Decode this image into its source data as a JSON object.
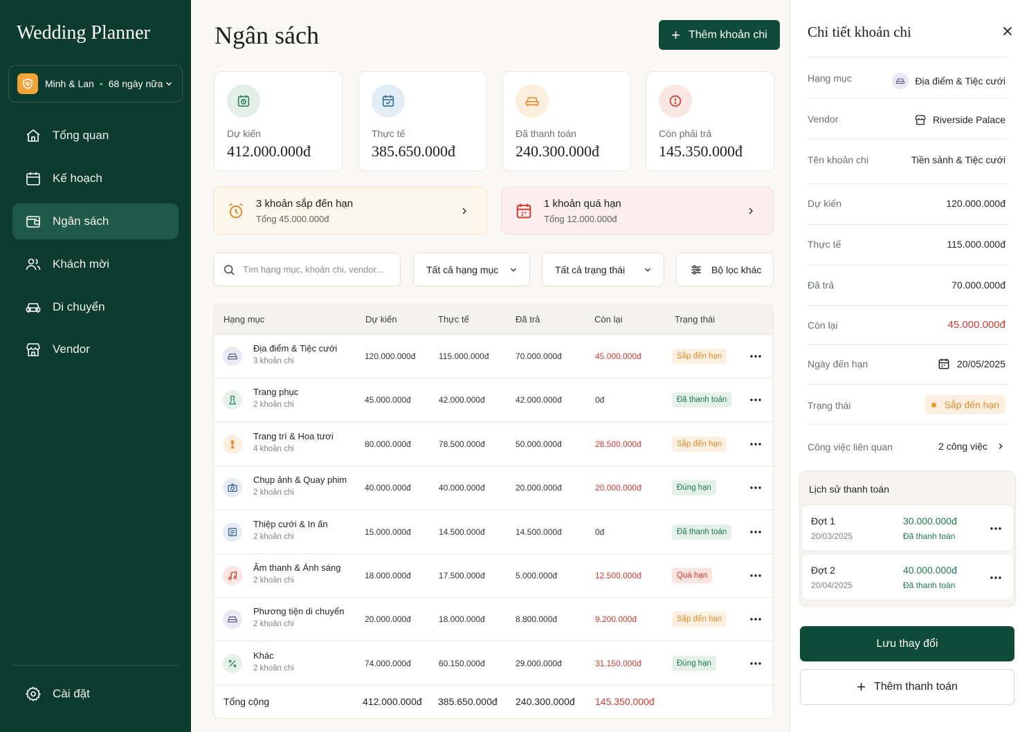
{
  "app": {
    "title": "Wedding Planner"
  },
  "couple": {
    "names": "Minh & Lan",
    "countdown": "68 ngày nữa"
  },
  "nav": [
    {
      "label": "Tổng quan",
      "icon": "home-icon"
    },
    {
      "label": "Kế hoạch",
      "icon": "calendar-icon"
    },
    {
      "label": "Ngân sách",
      "icon": "wallet-icon",
      "active": true
    },
    {
      "label": "Khách mời",
      "icon": "users-icon"
    },
    {
      "label": "Di chuyển",
      "icon": "car-icon"
    },
    {
      "label": "Vendor",
      "icon": "store-icon"
    }
  ],
  "settings": {
    "label": "Cài đặt",
    "icon": "gear-icon"
  },
  "page": {
    "title": "Ngân sách",
    "add_label": "Thêm khoản chi"
  },
  "summary": [
    {
      "label": "Dự kiến",
      "value": "412.000.000đ",
      "icon": "clock-calendar-icon",
      "color": "#2e7d5b"
    },
    {
      "label": "Thực tế",
      "value": "385.650.000đ",
      "icon": "calendar-check-icon",
      "color": "#2f6f9e"
    },
    {
      "label": "Đã thanh toán",
      "value": "240.300.000đ",
      "icon": "car-icon",
      "color": "#e08a2e"
    },
    {
      "label": "Còn phải trả",
      "value": "145.350.000đ",
      "icon": "alert-clock-icon",
      "color": "#d33a2f"
    }
  ],
  "alerts": {
    "upcoming": {
      "title": "3 khoản sắp đến hạn",
      "sub": "Tổng 45.000.000đ"
    },
    "overdue": {
      "title": "1 khoản quá hạn",
      "sub": "Tổng 12.000.000đ"
    }
  },
  "filters": {
    "search_placeholder": "Tìm hạng mục, khoản chi, vendor...",
    "category": "Tất cả hạng mục",
    "status": "Tất cả trạng thái",
    "more": "Bộ lọc khác"
  },
  "table": {
    "headers": [
      "Hạng mục",
      "Dự kiến",
      "Thực tế",
      "Đã trả",
      "Còn lại",
      "Trạng thái"
    ],
    "rows": [
      {
        "name": "Địa điểm & Tiệc cưới",
        "sub": "3 khoản chi",
        "icon": "car-icon",
        "planned": "120.000.000đ",
        "actual": "115.000.000đ",
        "paid": "70.000.000đ",
        "remaining": "45.000.000đ",
        "status": "Sắp đến hạn",
        "kind": "due"
      },
      {
        "name": "Trang phục",
        "sub": "2 khoản chi",
        "icon": "dress-icon",
        "planned": "45.000.000đ",
        "actual": "42.000.000đ",
        "paid": "42.000.000đ",
        "remaining": "0đ",
        "status": "Đã thanh toán",
        "kind": "paid"
      },
      {
        "name": "Trang trí & Hoa tươi",
        "sub": "4 khoản chi",
        "icon": "flower-icon",
        "planned": "80.000.000đ",
        "actual": "78.500.000đ",
        "paid": "50.000.000đ",
        "remaining": "28.500.000đ",
        "status": "Sắp đến hạn",
        "kind": "due"
      },
      {
        "name": "Chụp ảnh & Quay phim",
        "sub": "2 khoản chi",
        "icon": "camera-icon",
        "planned": "40.000.000đ",
        "actual": "40.000.000đ",
        "paid": "20.000.000đ",
        "remaining": "20.000.000đ",
        "status": "Đúng hạn",
        "kind": "ontime"
      },
      {
        "name": "Thiệp cưới & In ấn",
        "sub": "2 khoản chi",
        "icon": "card-icon",
        "planned": "15.000.000đ",
        "actual": "14.500.000đ",
        "paid": "14.500.000đ",
        "remaining": "0đ",
        "status": "Đã thanh toán",
        "kind": "paid"
      },
      {
        "name": "Âm thanh & Ánh sáng",
        "sub": "2 khoản chi",
        "icon": "music-icon",
        "planned": "18.000.000đ",
        "actual": "17.500.000đ",
        "paid": "5.000.000đ",
        "remaining": "12.500.000đ",
        "status": "Quá hạn",
        "kind": "overdue"
      },
      {
        "name": "Phương tiện di chuyển",
        "sub": "2 khoản chi",
        "icon": "car-icon",
        "planned": "20.000.000đ",
        "actual": "18.000.000đ",
        "paid": "8.800.000đ",
        "remaining": "9.200.000đ",
        "status": "Sắp đến hạn",
        "kind": "due"
      },
      {
        "name": "Khác",
        "sub": "2 khoản chi",
        "icon": "percent-icon",
        "planned": "74.000.000đ",
        "actual": "60.150.000đ",
        "paid": "29.000.000đ",
        "remaining": "31.150.000đ",
        "status": "Đúng hạn",
        "kind": "ontime"
      }
    ],
    "total": {
      "label": "Tổng cộng",
      "planned": "412.000.000đ",
      "actual": "385.650.000đ",
      "paid": "240.300.000đ",
      "remaining": "145.350.000đ"
    }
  },
  "detail": {
    "title": "Chi tiết khoản chi",
    "fields": {
      "category_label": "Hạng mục",
      "category": "Địa điểm & Tiệc cưới",
      "vendor_label": "Vendor",
      "vendor": "Riverside Palace",
      "name_label": "Tên khoản chi",
      "name": "Tiền sảnh & Tiệc cưới",
      "planned_label": "Dự kiến",
      "planned": "120.000.000đ",
      "actual_label": "Thực tế",
      "actual": "115.000.000đ",
      "paid_label": "Đã trả",
      "paid": "70.000.000đ",
      "remaining_label": "Còn lại",
      "remaining": "45.000.000đ",
      "due_label": "Ngày đến hạn",
      "due": "20/05/2025",
      "status_label": "Trạng thái",
      "status": "Sắp đến hạn",
      "tasks_label": "Công việc liên quan",
      "tasks": "2 công việc"
    },
    "history_title": "Lịch sử thanh toán",
    "payments": [
      {
        "name": "Đợt 1",
        "date": "20/03/2025",
        "amount": "30.000.000đ",
        "status": "Đã thanh toán"
      },
      {
        "name": "Đợt 2",
        "date": "20/04/2025",
        "amount": "40.000.000đ",
        "status": "Đã thanh toán"
      }
    ],
    "save_label": "Lưu thay đổi",
    "add_payment_label": "Thêm thanh toán"
  },
  "colors": {
    "sidebar": "#0d3b2e",
    "primary": "#0e4a38",
    "danger": "#d33a2f",
    "warning": "#e08a2e",
    "success": "#1e7a4f"
  }
}
